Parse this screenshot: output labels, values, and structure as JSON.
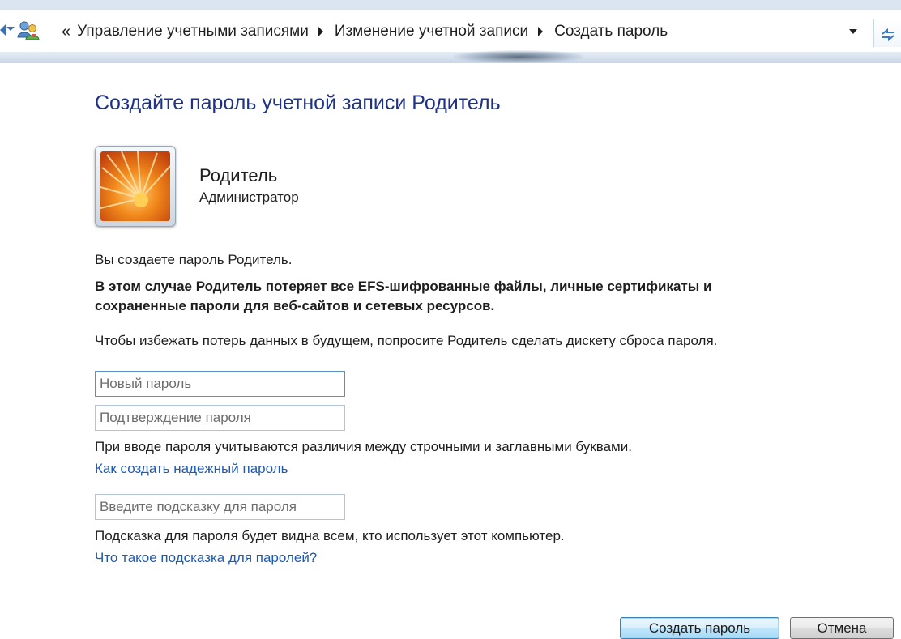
{
  "address_bar": {
    "overflow_label": "«",
    "breadcrumbs": [
      "Управление учетными записями",
      "Изменение учетной записи",
      "Создать пароль"
    ]
  },
  "page": {
    "title": "Создайте пароль учетной записи Родитель"
  },
  "user": {
    "name": "Родитель",
    "role": "Администратор"
  },
  "messages": {
    "creating": "Вы создаете пароль Родитель.",
    "warning_line1": "В этом случае Родитель потеряет все EFS-шифрованные файлы, личные сертификаты и",
    "warning_line2": "сохраненные пароли для веб-сайтов и сетевых ресурсов.",
    "advice": "Чтобы избежать потерь данных в будущем, попросите Родитель сделать дискету сброса пароля.",
    "case_note": "При вводе пароля учитываются различия между строчными и заглавными буквами.",
    "hint_note": "Подсказка для пароля будет видна всем, кто использует этот компьютер."
  },
  "fields": {
    "new_password": {
      "placeholder": "Новый пароль",
      "value": ""
    },
    "confirm_password": {
      "placeholder": "Подтверждение пароля",
      "value": ""
    },
    "hint": {
      "placeholder": "Введите подсказку для пароля",
      "value": ""
    }
  },
  "links": {
    "strong_password": "Как создать надежный пароль",
    "what_is_hint": "Что такое подсказка для паролей?"
  },
  "buttons": {
    "create": "Создать пароль",
    "cancel": "Отмена"
  },
  "colors": {
    "title": "#1e3287",
    "link": "#1c5ab8",
    "text": "#1e1e1e"
  }
}
